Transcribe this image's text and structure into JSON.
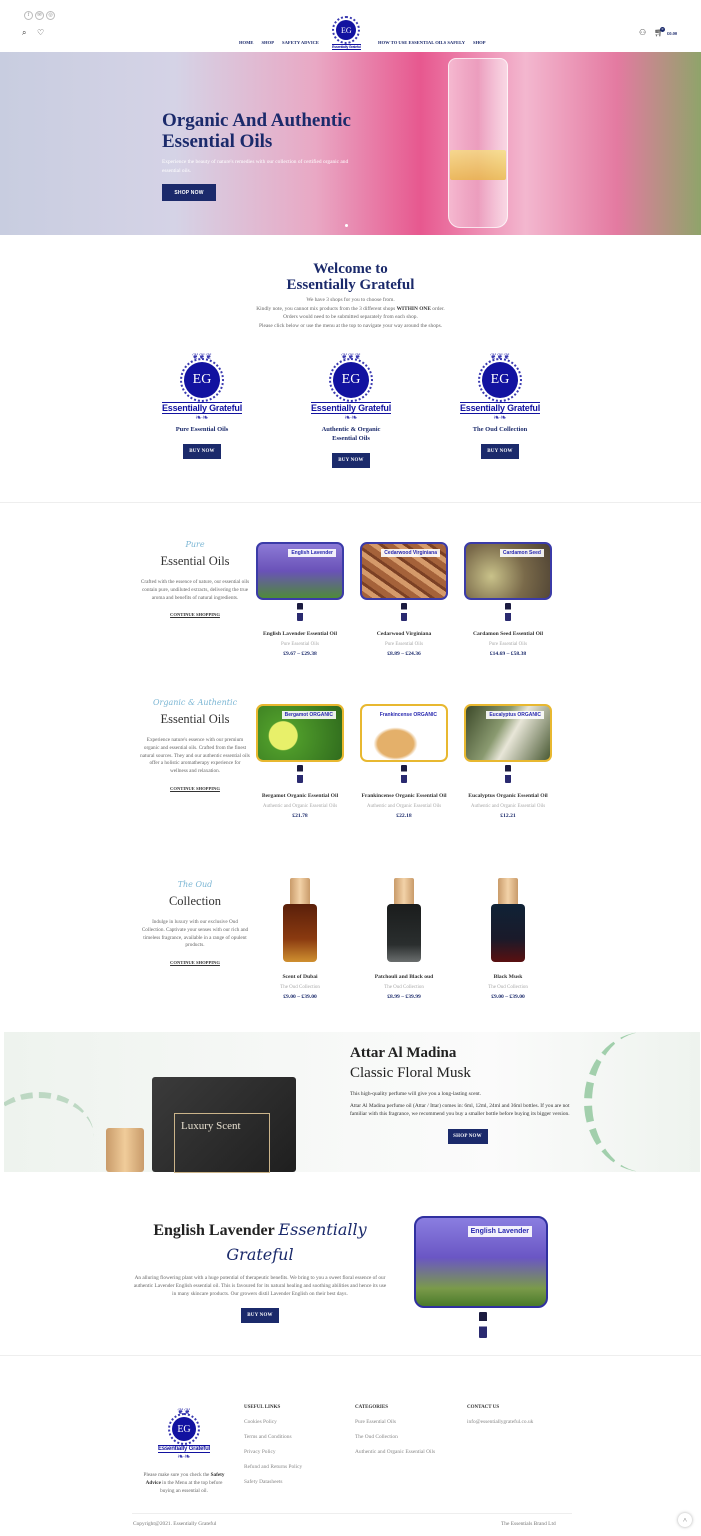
{
  "colors": {
    "accent": "#1b2a6b",
    "logo_blue": "#1212a0",
    "script_blue": "#7bb6d4"
  },
  "topbar": {
    "social": [
      {
        "icon": "facebook-icon",
        "glyph": "f"
      },
      {
        "icon": "email-icon",
        "glyph": "✉"
      },
      {
        "icon": "instagram-icon",
        "glyph": "◎"
      }
    ]
  },
  "header": {
    "nav_left": [
      "HOME",
      "SHOP",
      "SAFETY ADVICE"
    ],
    "nav_right": [
      "HOW TO USE ESSENTIAL OILS SAFELY",
      "SHOP"
    ],
    "cart_count": "0",
    "cart_total": "£0.00"
  },
  "logo": {
    "initials": "EG",
    "name": "Essentially Grateful"
  },
  "hero": {
    "title_line1": "Organic And Authentic",
    "title_line2": "Essential Oils",
    "subtitle": "Experience the beauty of nature's remedies with our collection of certified organic and essential oils.",
    "button": "SHOP NOW"
  },
  "welcome": {
    "title_line1": "Welcome to",
    "title_line2": "Essentially Grateful",
    "line1": "We have 3 shops for you to choose from.",
    "line2_pre": "Kindly note, you cannot mix products from the 3 different shops ",
    "line2_bold": "WITHIN ONE",
    "line2_post": " order.",
    "line3": "Orders would need to be submitted separately from each shop.",
    "line4": "Please click below or use the menu at the top to navigate your way around the shops.",
    "shops": [
      {
        "title": "Pure Essential Oils",
        "button": "BUY NOW"
      },
      {
        "title": "Authentic & Organic Essential Oils",
        "button": "BUY NOW"
      },
      {
        "title": "The Oud Collection",
        "button": "BUY NOW"
      }
    ]
  },
  "sections": [
    {
      "script": "Pure",
      "heading": "Essential Oils",
      "text": "Crafted with the essence of nature, our essential oils contain pure, undiluted extracts, delivering the true aroma and benefits of natural ingredients.",
      "link": "CONTINUE SHOPPING",
      "products": [
        {
          "label": "English Lavender",
          "name": "English Lavender Essential Oil",
          "category": "Pure Essential Oils",
          "price": "£9.67 – £29.38"
        },
        {
          "label": "Cedarwood Virginiana",
          "name": "Cedarwood Virginiana",
          "category": "Pure Essential Oils",
          "price": "£8.89 – £24.36"
        },
        {
          "label": "Cardamon Seed",
          "name": "Cardamon Seed Essential Oil",
          "category": "Pure Essential Oils",
          "price": "£14.69 – £58.38"
        }
      ]
    },
    {
      "script": "Organic & Authentic",
      "heading": "Essential Oils",
      "text": "Experience nature's essence with our premium organic and essential oils. Crafted from the finest natural sources. They and our authentic essential oils offer a holistic aromatherapy experience for wellness and relaxation.",
      "link": "CONTINUE SHOPPING",
      "products": [
        {
          "label": "Bergamot ORGANIC",
          "name": "Bergamot Organic Essential Oil",
          "category": "Authentic and Organic Essential Oils",
          "price": "£21.78"
        },
        {
          "label": "Frankincense ORGANIC",
          "name": "Frankincense Organic Essential Oil",
          "category": "Authentic and Organic Essential Oils",
          "price": "£22.18"
        },
        {
          "label": "Eucalyptus ORGANIC",
          "name": "Eucalyptus Organic Essential Oil",
          "category": "Authentic and Organic Essential Oils",
          "price": "£12.21"
        }
      ]
    },
    {
      "script": "The Oud",
      "heading": "Collection",
      "text": "Indulge in luxury with our exclusive Oud Collection. Captivate your senses with our rich and timeless fragrance, available in a range of opulent products.",
      "link": "CONTINUE SHOPPING",
      "products": [
        {
          "name": "Scent of Dubai",
          "category": "The Oud Collection",
          "price": "£9.00 – £39.00"
        },
        {
          "name": "Patchouli and Black oud",
          "category": "The Oud Collection",
          "price": "£8.99 – £39.99"
        },
        {
          "name": "Black Musk",
          "category": "The Oud Collection",
          "price": "£9.00 – £39.00"
        }
      ]
    }
  ],
  "attar": {
    "title": "Attar Al Madina",
    "subtitle": "Classic Floral Musk",
    "p1": "This high-quality perfume will give you a long-lasting scent.",
    "p2": "Attar Al Madina perfume oil (Attar / Ittar) comes in: 6ml, 12ml, 24ml and 36ml bottles. If you are not familiar with this fragrance, we recommend you buy a smaller bottle before buying its bigger version.",
    "button": "SHOP NOW",
    "box_text": "Luxury Scent"
  },
  "lavender": {
    "title": "English Lavender",
    "script": "Essentially Grateful",
    "text": "An alluring flowering plant with a huge potential of therapeutic benefits. We bring to you a sweet floral essence of our authentic Lavender English essential oil. This is favoured for its natural healing and soothing abilities and hence its use in many skincare products. Our growers distil Lavender English on their best days.",
    "button": "BUY NOW",
    "image_label": "English Lavender"
  },
  "footer": {
    "note_pre": "Please make sure you check the ",
    "note_bold": "Safety Advice",
    "note_post": " in the Menu at the top before buying an essential oil.",
    "useful_title": "USEFUL LINKS",
    "useful": [
      "Cookies Policy",
      "Terms and Conditions",
      "Privacy Policy",
      "Refund and Returns Policy",
      "Safety Datasheets"
    ],
    "categories_title": "CATEGORIES",
    "categories": [
      "Pure Essential Oils",
      "The Oud Collection",
      "Authentic and Organic Essential Oils"
    ],
    "contact_title": "CONTACT US",
    "email": "info@essentiallygrateful.co.uk",
    "copyright": "Copyright@2021. Essentially Grateful",
    "company": "The Essentials Brand Ltd"
  }
}
